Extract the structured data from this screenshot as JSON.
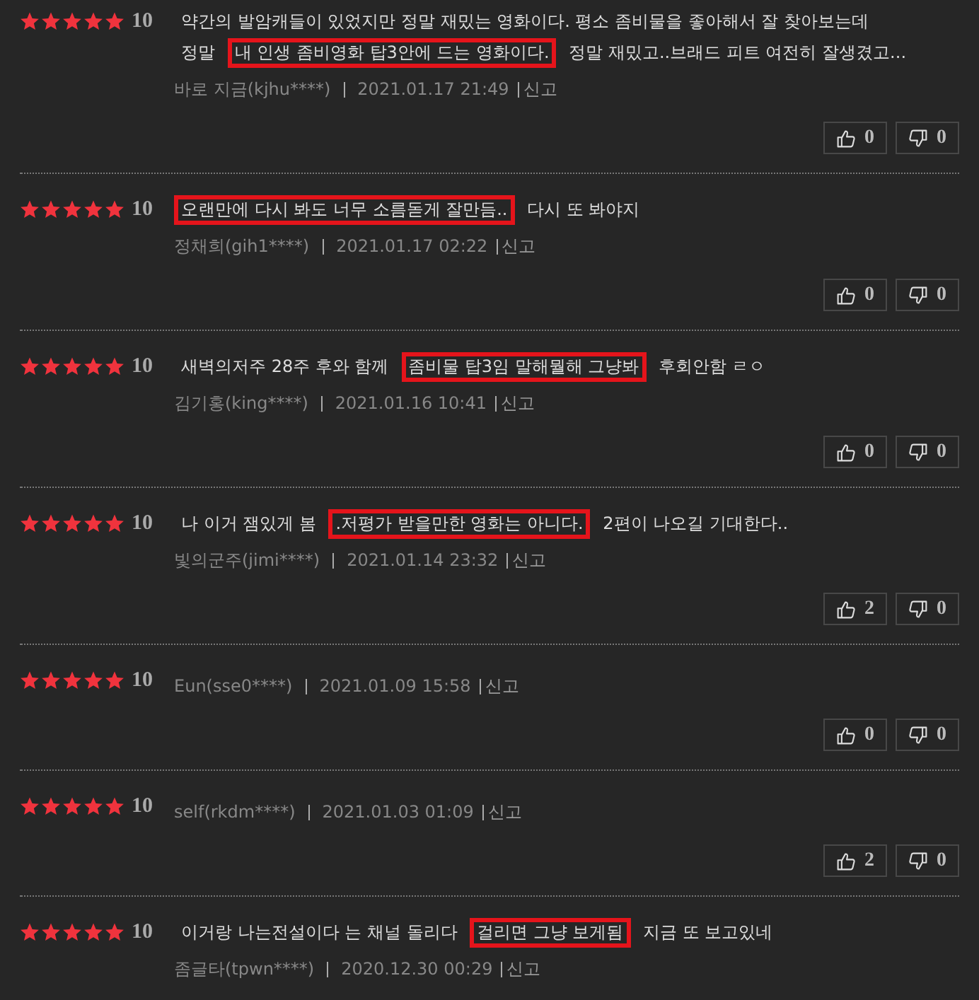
{
  "reviews": [
    {
      "stars": 5,
      "score": "10",
      "comment_lines": [
        [
          {
            "text": "약간의 발암캐들이 있었지만 정말 재밌는 영화이다. 평소 좀비물을 좋아해서 잘 찾아보는데",
            "highlighted": false
          }
        ],
        [
          {
            "text": "정말 ",
            "highlighted": false
          },
          {
            "text": "내 인생 좀비영화 탑3안에 드는 영화이다.",
            "highlighted": true
          },
          {
            "text": " 정말 재밌고..브래드 피트 여전히 잘생겼고...",
            "highlighted": false
          }
        ]
      ],
      "author": "바로 지금(kjhu****)",
      "date": "2021.01.17 21:49",
      "report": "신고",
      "likes": "0",
      "dislikes": "0"
    },
    {
      "stars": 5,
      "score": "10",
      "comment_lines": [
        [
          {
            "text": "오랜만에 다시 봐도 너무 소름돋게 잘만듬..",
            "highlighted": true
          },
          {
            "text": " 다시 또 봐야지",
            "highlighted": false
          }
        ]
      ],
      "author": "정채희(gih1****)",
      "date": "2021.01.17 02:22",
      "report": "신고",
      "likes": "0",
      "dislikes": "0"
    },
    {
      "stars": 5,
      "score": "10",
      "comment_lines": [
        [
          {
            "text": "새벽의저주 28주 후와 함께 ",
            "highlighted": false
          },
          {
            "text": "좀비물 탑3임 말해뭘해 그냥봐",
            "highlighted": true
          },
          {
            "text": " 후회안함 ㄹㅇ",
            "highlighted": false
          }
        ]
      ],
      "author": "김기홍(king****)",
      "date": "2021.01.16 10:41",
      "report": "신고",
      "likes": "0",
      "dislikes": "0"
    },
    {
      "stars": 5,
      "score": "10",
      "comment_lines": [
        [
          {
            "text": "나 이거 잼있게 봄 ",
            "highlighted": false
          },
          {
            "text": ".저평가 받을만한 영화는 아니다.",
            "highlighted": true
          },
          {
            "text": " 2편이 나오길 기대한다..",
            "highlighted": false
          }
        ]
      ],
      "author": "빛의군주(jimi****)",
      "date": "2021.01.14 23:32",
      "report": "신고",
      "likes": "2",
      "dislikes": "0"
    },
    {
      "stars": 5,
      "score": "10",
      "author": "Eun(sse0****)",
      "date": "2021.01.09 15:58",
      "report": "신고",
      "likes": "0",
      "dislikes": "0"
    },
    {
      "stars": 5,
      "score": "10",
      "author": "self(rkdm****)",
      "date": "2021.01.03 01:09",
      "report": "신고",
      "likes": "2",
      "dislikes": "0"
    },
    {
      "stars": 5,
      "score": "10",
      "comment_lines": [
        [
          {
            "text": "이거랑 나는전설이다 는 채널 돌리다 ",
            "highlighted": false
          },
          {
            "text": "걸리면 그냥 보게됨",
            "highlighted": true
          },
          {
            "text": " 지금 또 보고있네",
            "highlighted": false
          }
        ]
      ],
      "author": "좀글타(tpwn****)",
      "date": "2020.12.30 00:29",
      "report": "신고"
    }
  ]
}
